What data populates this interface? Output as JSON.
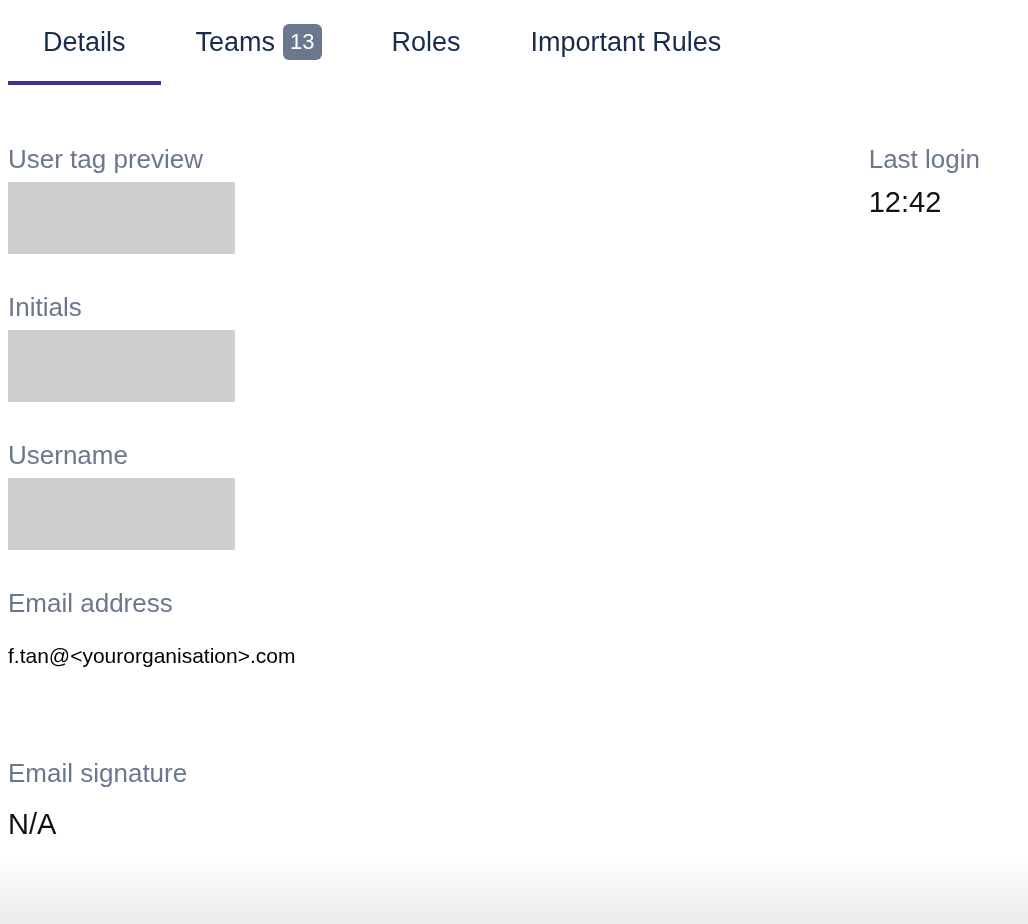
{
  "tabs": [
    {
      "label": "Details",
      "selected": true
    },
    {
      "label": "Teams",
      "selected": false,
      "badge": "13"
    },
    {
      "label": "Roles",
      "selected": false
    },
    {
      "label": "Important Rules",
      "selected": false
    }
  ],
  "fields": [
    {
      "label": "User tag preview",
      "kind": "redacted"
    },
    {
      "label": "Initials",
      "kind": "redacted"
    },
    {
      "label": "Username",
      "kind": "redacted"
    },
    {
      "label": "Email address",
      "kind": "small",
      "value": "f.tan@<yourorganisation>.com"
    },
    {
      "label": "Email signature",
      "kind": "text",
      "value": "N/A"
    }
  ],
  "last_login": {
    "label": "Last login",
    "value": "12:42"
  }
}
